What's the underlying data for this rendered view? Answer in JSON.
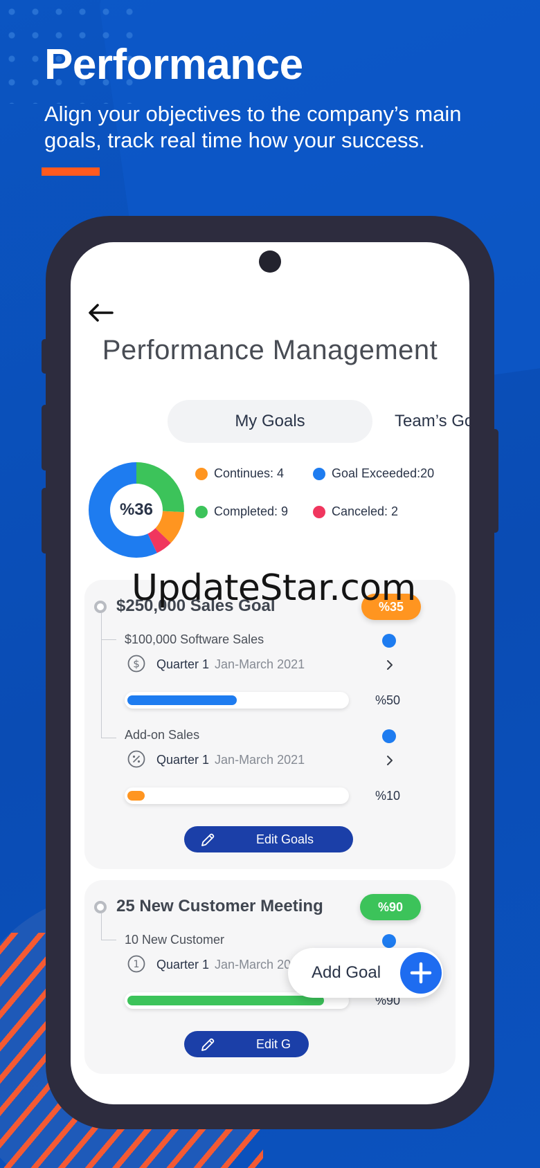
{
  "hero": {
    "title": "Performance",
    "subtitle": "Align your objectives to the company’s main goals, track real time how your success."
  },
  "app": {
    "title": "Performance Management",
    "tabs": [
      {
        "label": "My Goals",
        "active": true
      },
      {
        "label": "Team’s Go",
        "active": false
      }
    ]
  },
  "summary": {
    "overall_percent": "%36",
    "legend": [
      {
        "label": "Continues: 4",
        "color": "#ff9520"
      },
      {
        "label": "Goal Exceeded:20",
        "color": "#1e7cf0"
      },
      {
        "label": "Completed: 9",
        "color": "#3cc35a"
      },
      {
        "label": "Canceled: 2",
        "color": "#f0365e"
      }
    ],
    "donut_segments": [
      {
        "name": "Completed",
        "value": 9,
        "color": "#3cc35a"
      },
      {
        "name": "Continues",
        "value": 4,
        "color": "#ff9520"
      },
      {
        "name": "Canceled",
        "value": 2,
        "color": "#f0365e"
      },
      {
        "name": "Goal Exceeded",
        "value": 20,
        "color": "#1e7cf0"
      }
    ]
  },
  "goals": [
    {
      "title": "$250,000 Sales Goal",
      "badge": "%35",
      "badge_color": "#ff9520",
      "subgoals": [
        {
          "name": "$100,000 Software Sales",
          "icon": "dollar-icon",
          "quarter": "Quarter 1",
          "date": "Jan-March 2021",
          "progress": 0.5,
          "percent": "%50",
          "bar_color": "#1e7cf0"
        },
        {
          "name": "Add-on Sales",
          "icon": "percent-icon",
          "quarter": "Quarter 1",
          "date": "Jan-March 2021",
          "progress": 0.08,
          "percent": "%10",
          "bar_color": "#ff9520"
        }
      ],
      "edit_label": "Edit Goals"
    },
    {
      "title": "25 New Customer Meeting",
      "badge": "%90",
      "badge_color": "#3cc35a",
      "subgoals": [
        {
          "name": "10 New Customer",
          "icon": "number-one-icon",
          "quarter": "Quarter 1",
          "date": "Jan-March 2021",
          "progress": 0.9,
          "percent": "%90",
          "bar_color": "#3cc35a"
        }
      ],
      "edit_label": "Edit G"
    }
  ],
  "fab": {
    "label": "Add Goal"
  },
  "watermark": "UpdateStar.com"
}
